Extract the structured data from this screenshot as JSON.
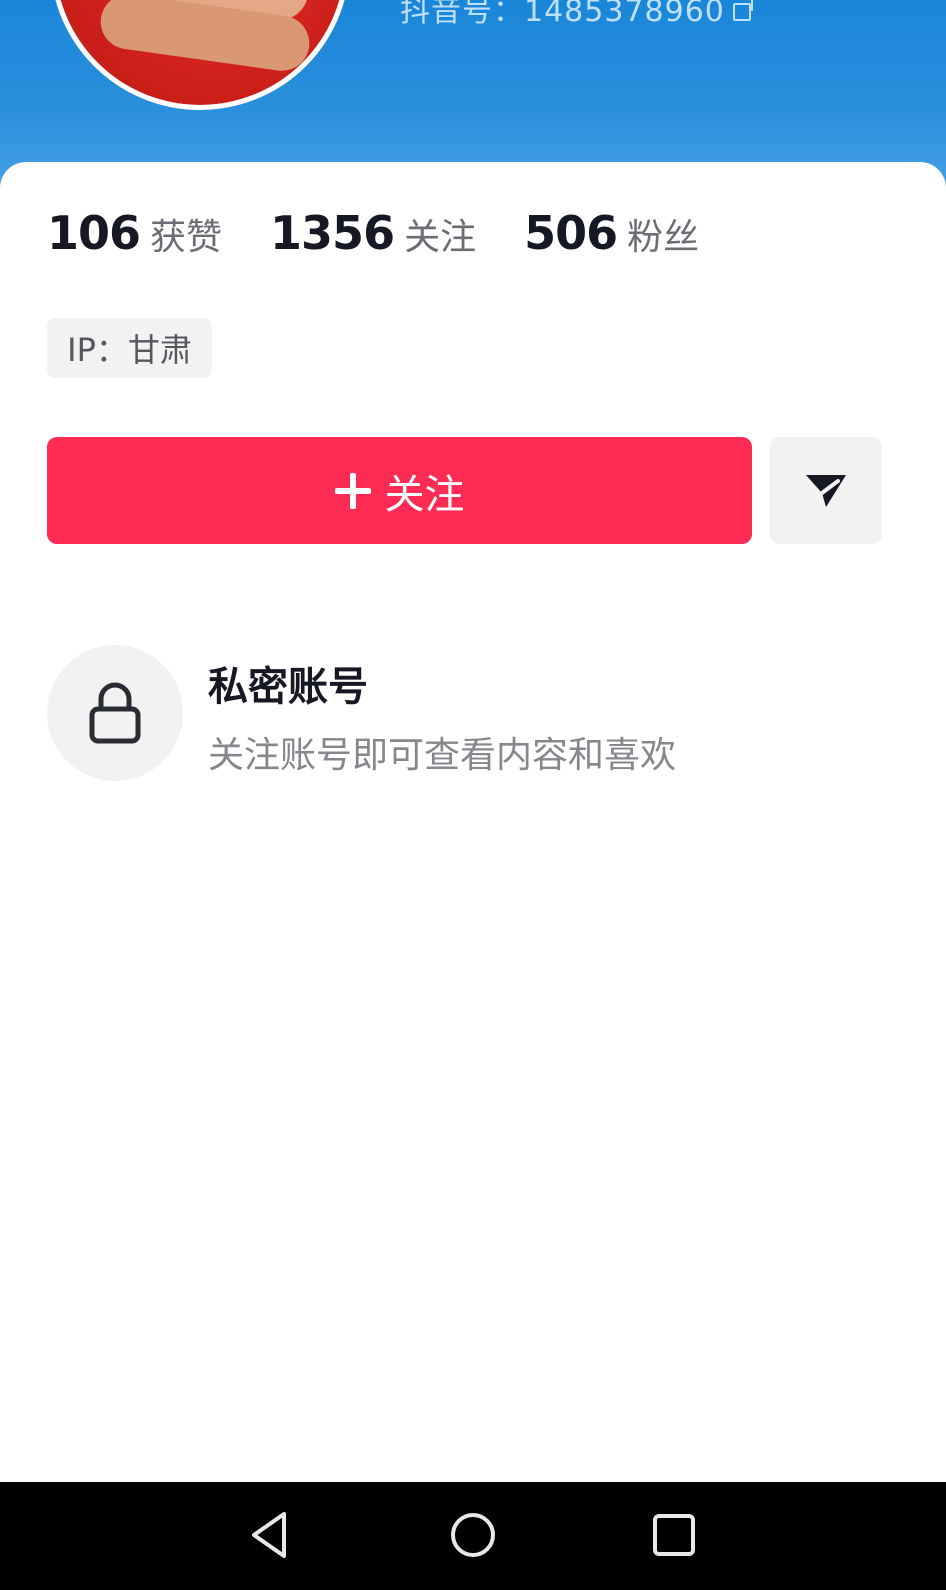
{
  "header": {
    "douyin_id": "抖音号：1485378960",
    "copy_icon": "copy-icon",
    "background_color": "#1a86d8"
  },
  "stats": [
    {
      "value": "106",
      "label": "获赞"
    },
    {
      "value": "1356",
      "label": "关注"
    },
    {
      "value": "506",
      "label": "粉丝"
    }
  ],
  "ip_location": "IP：甘肃",
  "actions": {
    "follow_label": "关注",
    "follow_color": "#fe2c55",
    "message_icon": "send-icon"
  },
  "private_notice": {
    "title": "私密账号",
    "subtitle": "关注账号即可查看内容和喜欢",
    "icon": "lock-icon"
  },
  "nav_bar": {
    "back_icon": "back-triangle-icon",
    "home_icon": "home-circle-icon",
    "recents_icon": "recents-square-icon"
  }
}
